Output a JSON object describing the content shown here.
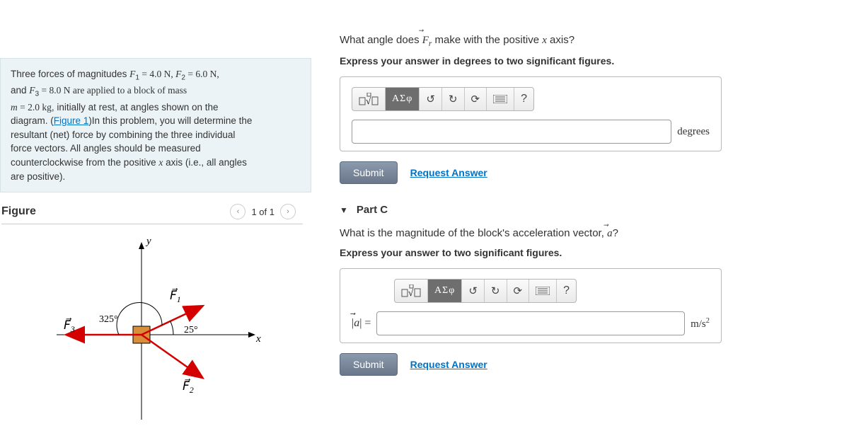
{
  "problem": {
    "text_pre": "Three forces of magnitudes ",
    "f1_var": "F",
    "f1_sub": "1",
    "eq1": " = 4.0 N, ",
    "f2_var": "F",
    "f2_sub": "2",
    "eq2": " = 6.0 N,",
    "line2_pre": "and ",
    "f3_var": "F",
    "f3_sub": "3",
    "eq3": " = 8.0 N are applied to a block of mass",
    "line3_pre": "m = 2.0 kg, initially at rest, at angles shown on the",
    "line4_pre": "diagram. (",
    "fig_link": "Figure 1",
    "line4_post": ")In this problem, you will determine the",
    "line5": "resultant (net) force by combining the three individual",
    "line6": "force vectors. All angles should be measured",
    "line7_pre": "counterclockwise from the positive ",
    "line7_x": "x",
    "line7_post": " axis (i.e., all angles",
    "line8": "are positive)."
  },
  "figure": {
    "title": "Figure",
    "counter": "1 of 1",
    "labels": {
      "y": "y",
      "x": "x",
      "F1": "F",
      "F1sub": "1",
      "F2": "F",
      "F2sub": "2",
      "F3": "F",
      "F3sub": "3",
      "a325": "325°",
      "a25": "25°"
    }
  },
  "partB": {
    "prompt_pre": "What angle does ",
    "prompt_var": "F⃗",
    "prompt_varSub": "r",
    "prompt_post": " make with the positive ",
    "prompt_x": "x",
    "prompt_end": " axis?",
    "instr": "Express your answer in degrees to two significant figures.",
    "unit": "degrees",
    "submit": "Submit",
    "request": "Request Answer",
    "greek": "ΑΣφ",
    "help": "?",
    "value": ""
  },
  "partC": {
    "header": "Part C",
    "prompt_pre": "What is the magnitude of the block's acceleration vector, ",
    "prompt_var": "a⃗",
    "prompt_end": "?",
    "instr": "Express your answer to two significant figures.",
    "prefix": "|a⃗| =",
    "unit_html": "m/s²",
    "submit": "Submit",
    "request": "Request Answer",
    "greek": "ΑΣφ",
    "help": "?",
    "value": ""
  }
}
